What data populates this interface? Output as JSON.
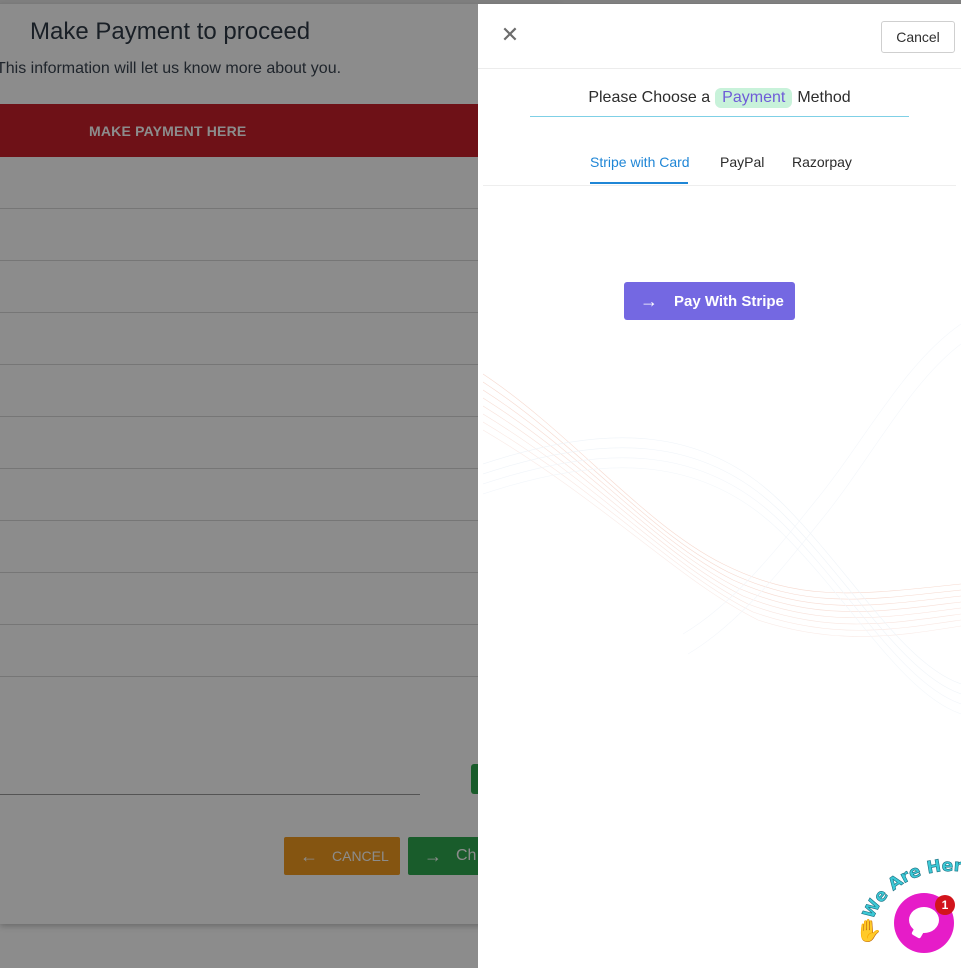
{
  "background": {
    "title": "Make Payment to proceed",
    "subtitle": "This information will let us know more about you.",
    "banner_label": "MAKE PAYMENT HERE",
    "row_count_visual": 10,
    "cancel_label": "CANCEL",
    "check_label": "Ch"
  },
  "drawer": {
    "close_icon": "close-icon",
    "cancel_label": "Cancel",
    "heading_prefix": "Please Choose a",
    "heading_highlight": "Payment",
    "heading_suffix": "Method",
    "tabs": [
      {
        "label": "Stripe with Card",
        "active": true
      },
      {
        "label": "PayPal",
        "active": false
      },
      {
        "label": "Razorpay",
        "active": false
      }
    ],
    "pay_button_label": "Pay With Stripe",
    "pay_button_icon": "arrow-right-icon"
  },
  "chat_widget": {
    "label": "We Are Here!",
    "badge_count": "1",
    "icon": "chat-bubble-icon"
  },
  "colors": {
    "banner": "#c8202a",
    "accent_tab": "#1f86d6",
    "pay_button": "#7468e2",
    "highlight_bg": "#c8f2da",
    "chat": "#e61cc8",
    "cancel_bg": "#f39c1f",
    "check_bg": "#2fa84f"
  }
}
